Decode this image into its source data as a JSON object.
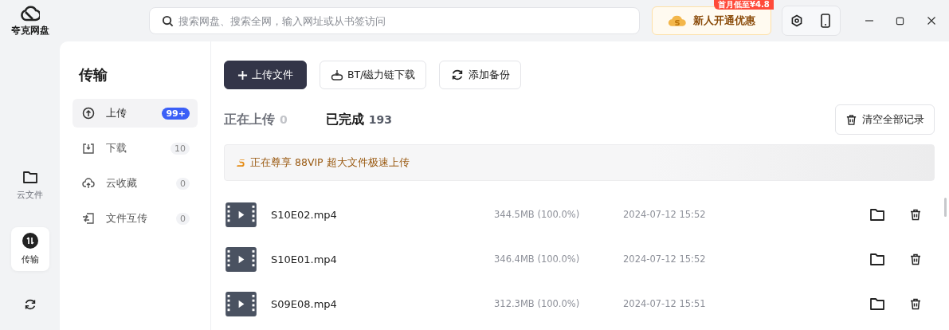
{
  "app": {
    "name": "夸克网盘"
  },
  "search": {
    "placeholder": "搜索网盘、搜索全网，输入网址或从书签访问"
  },
  "promo": {
    "label": "新人开通优惠",
    "badge": "首月低至¥4.8"
  },
  "rail": [
    {
      "label": "云文件",
      "selected": false
    },
    {
      "label": "传输",
      "selected": true
    },
    {
      "selected": false
    }
  ],
  "panel": {
    "title": "传输"
  },
  "nav": [
    {
      "label": "上传",
      "count": "99+",
      "selected": true
    },
    {
      "label": "下载",
      "count": "10",
      "selected": false
    },
    {
      "label": "云收藏",
      "count": "0",
      "selected": false
    },
    {
      "label": "文件互传",
      "count": "0",
      "selected": false
    }
  ],
  "toolbar": [
    {
      "label": "上传文件",
      "kind": "primary"
    },
    {
      "label": "BT/磁力链下载",
      "kind": "secondary"
    },
    {
      "label": "添加备份",
      "kind": "secondary"
    }
  ],
  "tabs": [
    {
      "label": "正在上传",
      "count": "0",
      "selected": false
    },
    {
      "label": "已完成",
      "count": "193",
      "selected": true
    }
  ],
  "clear_button": "清空全部记录",
  "vip_banner": "正在尊享 88VIP 超大文件极速上传",
  "files": [
    {
      "name": "S10E02.mp4",
      "size": "344.5MB (100.0%)",
      "time": "2024-07-12 15:52"
    },
    {
      "name": "S10E01.mp4",
      "size": "346.4MB (100.0%)",
      "time": "2024-07-12 15:52"
    },
    {
      "name": "S09E08.mp4",
      "size": "312.3MB (100.0%)",
      "time": "2024-07-12 15:51"
    }
  ]
}
